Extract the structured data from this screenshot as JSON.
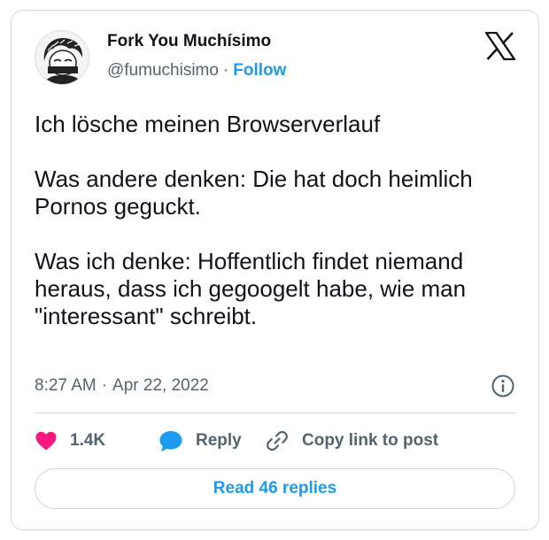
{
  "author": {
    "display_name": "Fork You Muchísimo",
    "handle": "@fumuchisimo",
    "separator": "·",
    "follow_label": "Follow"
  },
  "tweet": {
    "text": "Ich lösche meinen Browserverlauf\n\nWas andere denken: Die hat doch heimlich Pornos geguckt.\n\nWas ich denke: Hoffentlich findet niemand heraus, dass ich gegoogelt habe, wie man \"interessant\" schreibt.",
    "time": "8:27 AM",
    "meta_separator": "·",
    "date": "Apr 22, 2022"
  },
  "actions": {
    "like_count": "1.4K",
    "reply_label": "Reply",
    "copy_link_label": "Copy link to post"
  },
  "footer": {
    "read_replies_label": "Read 46 replies"
  },
  "icons": {
    "brand": "x-logo-icon",
    "info": "info-icon",
    "like": "heart-icon",
    "reply": "speech-bubble-icon",
    "copy": "link-icon"
  },
  "colors": {
    "accent": "#1d9bf0",
    "like": "#f91880",
    "text_primary": "#0f1419",
    "text_secondary": "#536471",
    "border": "#cfd9de"
  }
}
